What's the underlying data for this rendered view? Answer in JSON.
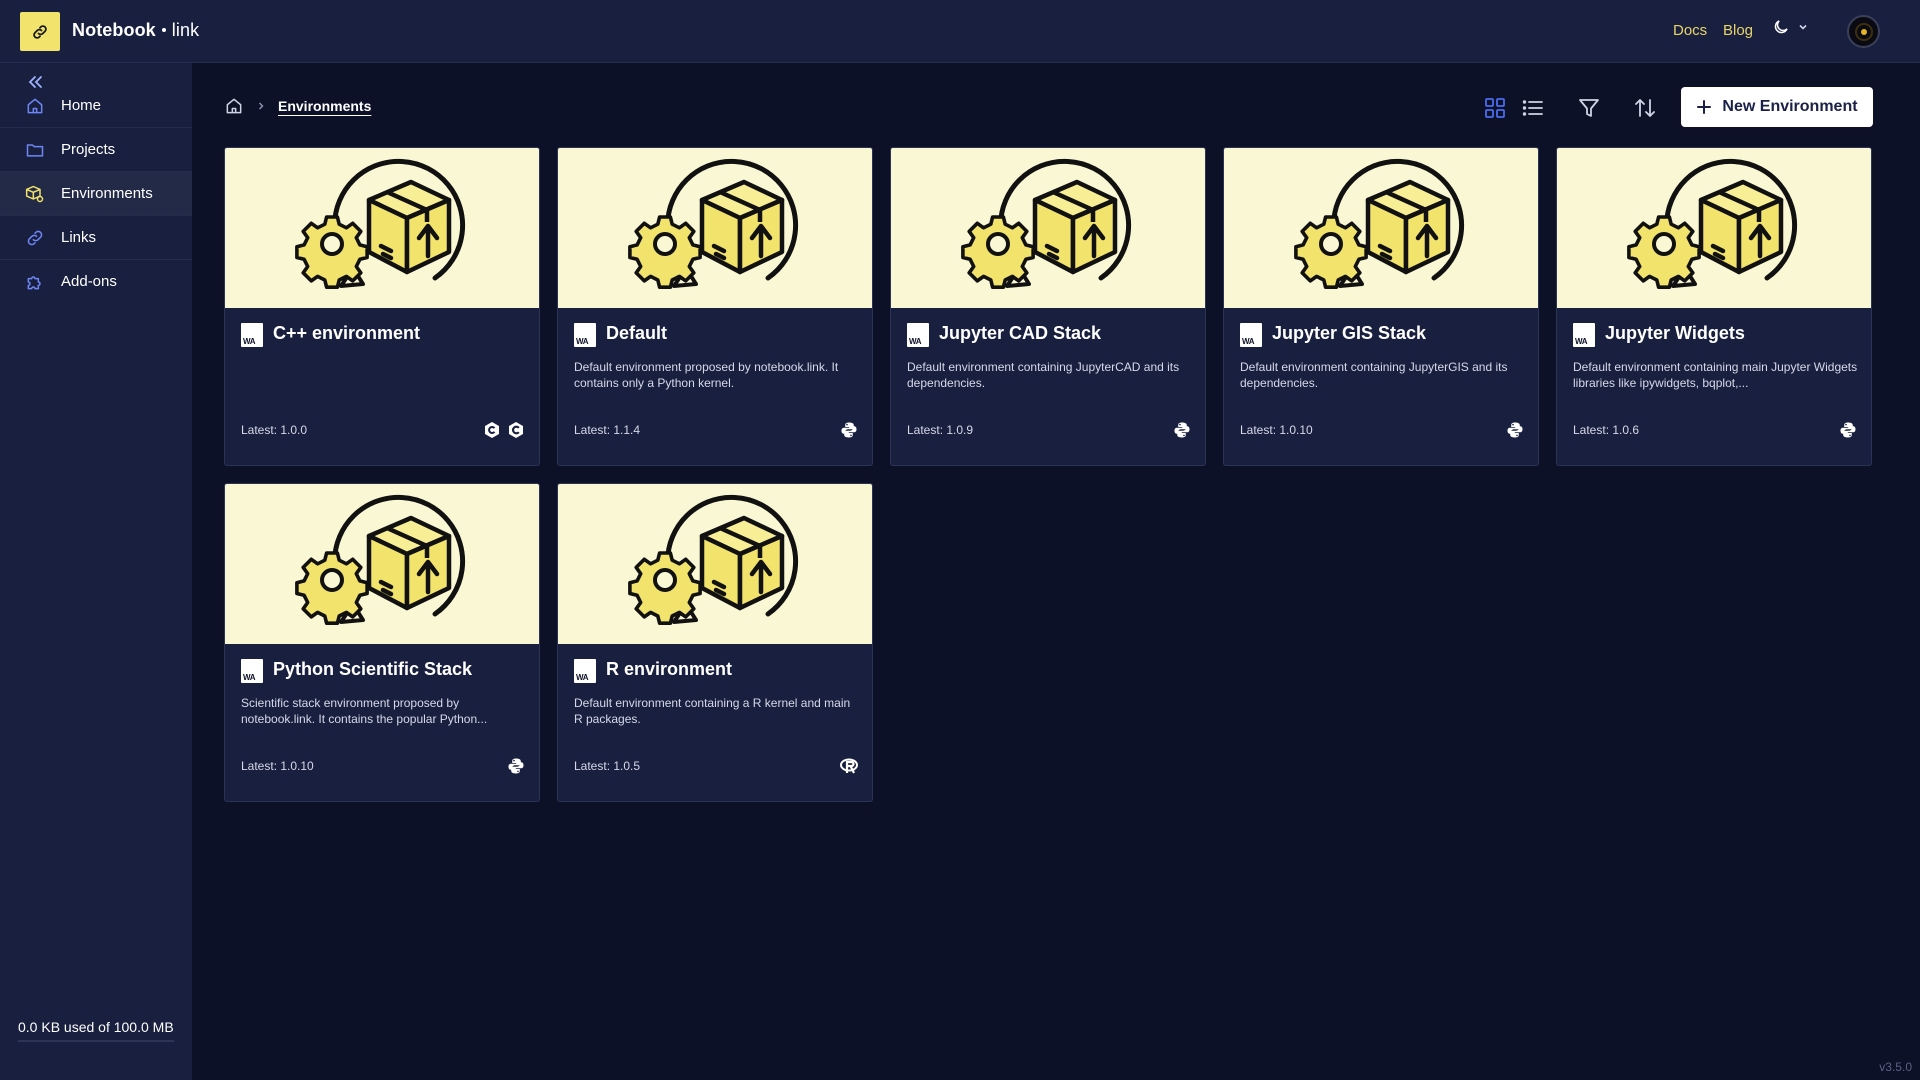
{
  "app": {
    "brand_a": "Notebook",
    "brand_b": "link",
    "nav_links": [
      "Docs",
      "Blog"
    ],
    "version": "v3.5.0"
  },
  "sidebar": {
    "items": [
      {
        "label": "Home",
        "icon": "home-icon"
      },
      {
        "label": "Projects",
        "icon": "folder-icon"
      },
      {
        "label": "Environments",
        "icon": "environment-icon"
      },
      {
        "label": "Links",
        "icon": "link-icon"
      },
      {
        "label": "Add-ons",
        "icon": "puzzle-icon"
      }
    ],
    "active": "Environments",
    "storage_text": "0.0 KB used of 100.0 MB",
    "storage_fraction": 0.0
  },
  "breadcrumb": {
    "current": "Environments"
  },
  "toolbar": {
    "new_button_label": "New Environment"
  },
  "colors": {
    "accent": "#f1e36b",
    "background": "#0d1127",
    "panel": "#19203f",
    "card_image": "#faf8d4",
    "grid_view_active": "#4b6cf0"
  },
  "environments": [
    {
      "title": "C++ environment",
      "description": "",
      "version": "Latest: 1.0.0",
      "kernels": [
        "cpp-icon",
        "c-icon"
      ]
    },
    {
      "title": "Default",
      "description": "Default environment proposed by notebook.link. It contains only a Python kernel.",
      "version": "Latest: 1.1.4",
      "kernels": [
        "python-icon"
      ]
    },
    {
      "title": "Jupyter CAD Stack",
      "description": "Default environment containing JupyterCAD and its dependencies.",
      "version": "Latest: 1.0.9",
      "kernels": [
        "python-icon"
      ]
    },
    {
      "title": "Jupyter GIS Stack",
      "description": "Default environment containing JupyterGIS and its dependencies.",
      "version": "Latest: 1.0.10",
      "kernels": [
        "python-icon"
      ]
    },
    {
      "title": "Jupyter Widgets",
      "description": "Default environment containing main Jupyter Widgets libraries like ipywidgets, bqplot,...",
      "version": "Latest: 1.0.6",
      "kernels": [
        "python-icon"
      ]
    },
    {
      "title": "Python Scientific Stack",
      "description": "Scientific stack environment proposed by notebook.link. It contains the popular Python...",
      "version": "Latest: 1.0.10",
      "kernels": [
        "python-icon"
      ]
    },
    {
      "title": "R environment",
      "description": "Default environment containing a R kernel and main R packages.",
      "version": "Latest: 1.0.5",
      "kernels": [
        "r-icon"
      ]
    }
  ]
}
